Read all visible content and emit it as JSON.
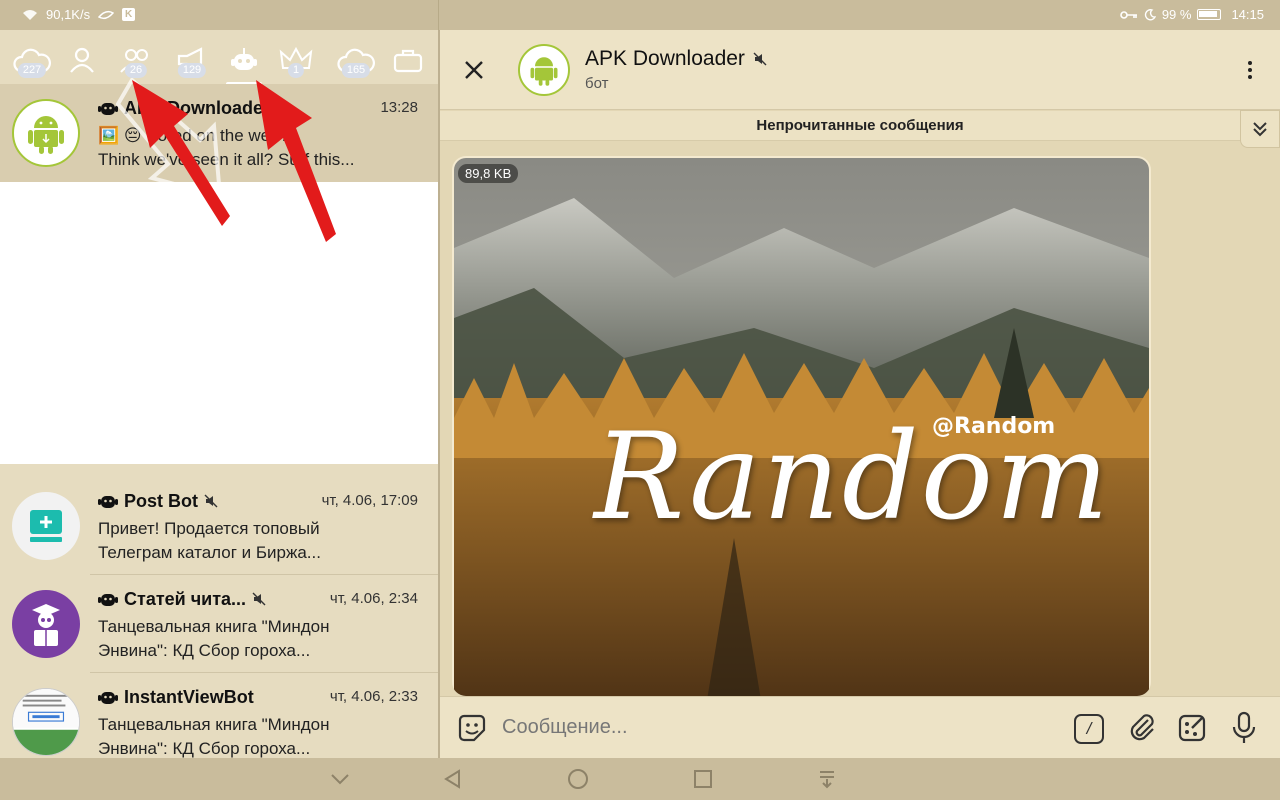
{
  "status_bar": {
    "network_speed": "90,1K/s",
    "k_badge": "K",
    "battery": "99 %",
    "time": "14:15"
  },
  "folder_tabs": [
    {
      "id": "all",
      "badge": "227",
      "icon": "cloud-icon"
    },
    {
      "id": "personal",
      "badge": "",
      "icon": "person-icon"
    },
    {
      "id": "groups",
      "badge": "26",
      "icon": "group-icon"
    },
    {
      "id": "channels",
      "badge": "129",
      "icon": "megaphone-icon"
    },
    {
      "id": "bots",
      "badge": "",
      "icon": "bot-icon"
    },
    {
      "id": "admin",
      "badge": "1",
      "icon": "crown-icon"
    },
    {
      "id": "unread",
      "badge": "165",
      "icon": "cloud-icon"
    },
    {
      "id": "archive",
      "badge": "",
      "icon": "briefcase-icon"
    }
  ],
  "chats": [
    {
      "name": "APK Downloader",
      "time": "13:28",
      "line1": "🖼️ 😔 Bored on the web?",
      "line2": "Think we've seen it all? Surf this..."
    },
    {
      "name": "Post Bot",
      "time": "чт, 4.06, 17:09",
      "line1": "Привет! Продается топовый",
      "line2": "Телеграм каталог и Биржа..."
    },
    {
      "name": "Статей чита...",
      "time": "чт, 4.06, 2:34",
      "line1": "Танцевальная книга \"Миндон",
      "line2": "Энвина\": КД Сбор гороха..."
    },
    {
      "name": "InstantViewBot",
      "time": "чт, 4.06, 2:33",
      "line1": "Танцевальная книга \"Миндон",
      "line2": "Энвина\": КД Сбор гороха..."
    }
  ],
  "header": {
    "title": "APK Downloader",
    "subtitle": "бот"
  },
  "unread_label": "Непрочитанные сообщения",
  "photo_message": {
    "file_size": "89,8 KB",
    "tag": "@Random",
    "word": "Random"
  },
  "composer": {
    "placeholder": "Сообщение...",
    "cmd_label": "/"
  },
  "colors": {
    "theme_bg": "#e6dcc0",
    "status_bar": "#c9bc9c",
    "android_green": "#a4c639",
    "arrow_red": "#e21b1b"
  }
}
